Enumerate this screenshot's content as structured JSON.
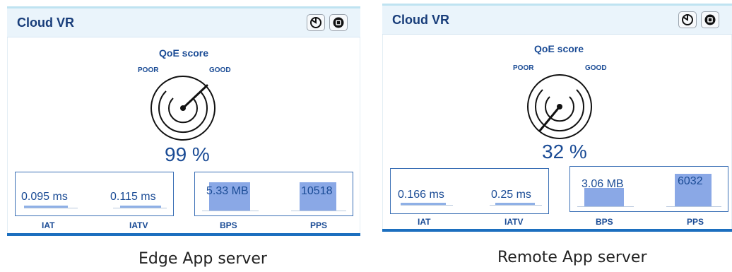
{
  "panels": [
    {
      "title": "Cloud VR",
      "qoe_label": "QoE score",
      "poor_label": "POOR",
      "good_label": "GOOD",
      "score_text": "99 %",
      "score_fraction": 0.99,
      "iat_value": "0.095 ms",
      "iatv_value": "0.115 ms",
      "bps_value": "5.33 MB",
      "pps_value": "10518",
      "iat_label": "IAT",
      "iatv_label": "IATV",
      "bps_label": "BPS",
      "pps_label": "PPS",
      "caption": "Edge App server",
      "icons": [
        "refresh-icon",
        "stop-icon"
      ]
    },
    {
      "title": "Cloud VR",
      "qoe_label": "QoE score",
      "poor_label": "POOR",
      "good_label": "GOOD",
      "score_text": "32 %",
      "score_fraction": 0.32,
      "iat_value": "0.166 ms",
      "iatv_value": "0.25 ms",
      "bps_value": "3.06 MB",
      "pps_value": "6032",
      "iat_label": "IAT",
      "iatv_label": "IATV",
      "bps_label": "BPS",
      "pps_label": "PPS",
      "caption": "Remote App server",
      "icons": [
        "refresh-icon",
        "stop-icon"
      ]
    }
  ],
  "colors": {
    "accent": "#1a4b95",
    "header_bg": "#eaf4fb",
    "bar_fill": "#8aa8e6"
  }
}
